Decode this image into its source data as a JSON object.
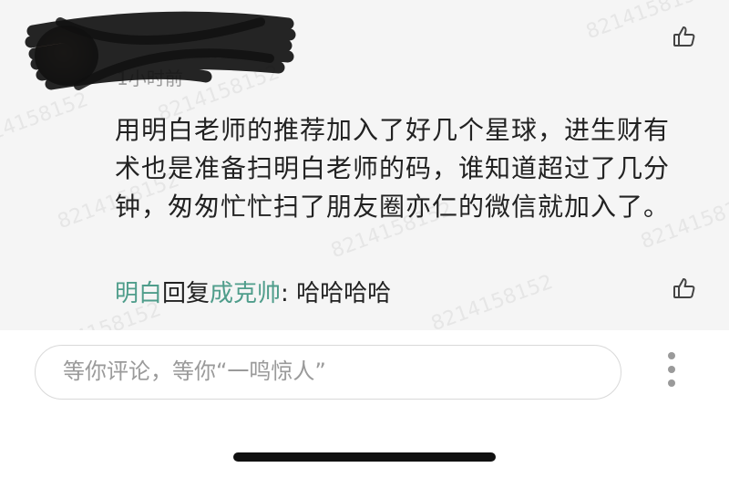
{
  "comment": {
    "time": "1小时前",
    "text": "用明白老师的推荐加入了好几个星球，进生财有术也是准备扫明白老师的码，谁知道超过了几分钟，匆匆忙忙扫了朋友圈亦仁的微信就加入了。",
    "like_icon": "thumbs-up-icon"
  },
  "reply": {
    "from": "明白",
    "verb": "回复",
    "to": "成克帅",
    "separator": ": ",
    "text": "哈哈哈哈",
    "like_icon": "thumbs-up-icon"
  },
  "watermark": "8214158152",
  "input": {
    "placeholder": "等你评论，等你“一鸣惊人”"
  },
  "menu": {
    "icon": "more-vertical-icon"
  },
  "colors": {
    "accent": "#4f9d8b",
    "panel_bg": "#f5f5f5",
    "text": "#222222",
    "secondary": "#9a9a9a"
  }
}
